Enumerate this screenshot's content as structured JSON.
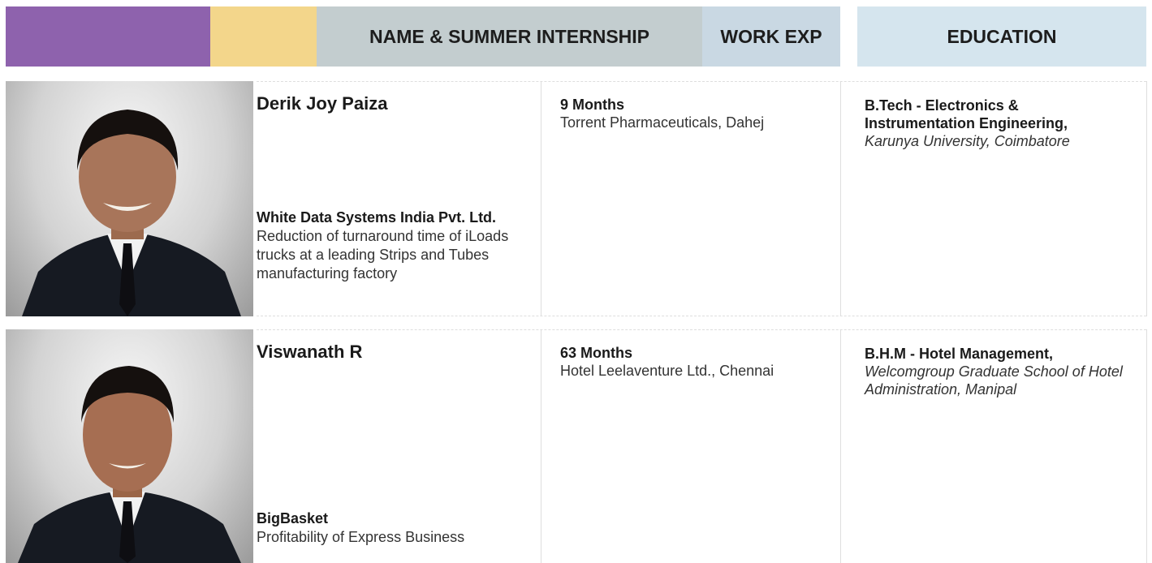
{
  "header": {
    "name_label": "NAME & SUMMER INTERNSHIP",
    "work_label": "WORK EXP",
    "education_label": "EDUCATION",
    "colors": {
      "purple": "#8e62ad",
      "yellow": "#f3d68b",
      "grey": "#c3cdcf",
      "work": "#c9d8e3",
      "education": "#d5e5ee"
    }
  },
  "profiles": [
    {
      "name": "Derik Joy Paiza",
      "internship_company": "White Data Systems India Pvt. Ltd.",
      "internship_project": "Reduction of turnaround time of iLoads trucks at a leading Strips and Tubes manufacturing factory",
      "work_duration": "9 Months",
      "work_company": "Torrent Pharmaceuticals, Dahej",
      "degree": "B.Tech - Electronics & Instrumentation Engineering,",
      "institution": "Karunya University, Coimbatore"
    },
    {
      "name": "Viswanath R",
      "internship_company": "BigBasket",
      "internship_project": "Profitability of Express Business",
      "work_duration": "63 Months",
      "work_company": "Hotel Leelaventure Ltd., Chennai",
      "degree": "B.H.M - Hotel Management,",
      "institution": "Welcomgroup Graduate School of Hotel Administration, Manipal"
    }
  ]
}
